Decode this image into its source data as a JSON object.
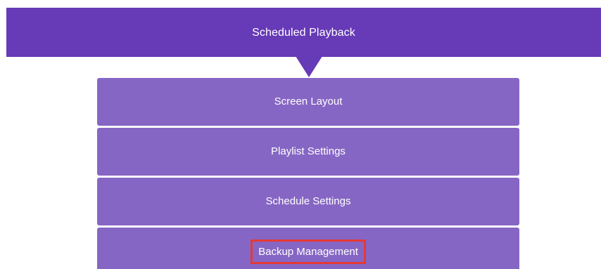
{
  "header": {
    "title": "Scheduled Playback"
  },
  "menu": {
    "items": [
      {
        "label": "Screen Layout"
      },
      {
        "label": "Playlist Settings"
      },
      {
        "label": "Schedule Settings"
      },
      {
        "label": "Backup Management",
        "highlighted": true
      }
    ]
  },
  "colors": {
    "header_bg": "#673ab7",
    "item_bg": "#8666c4",
    "highlight_border": "#e53935",
    "text": "#ffffff"
  }
}
